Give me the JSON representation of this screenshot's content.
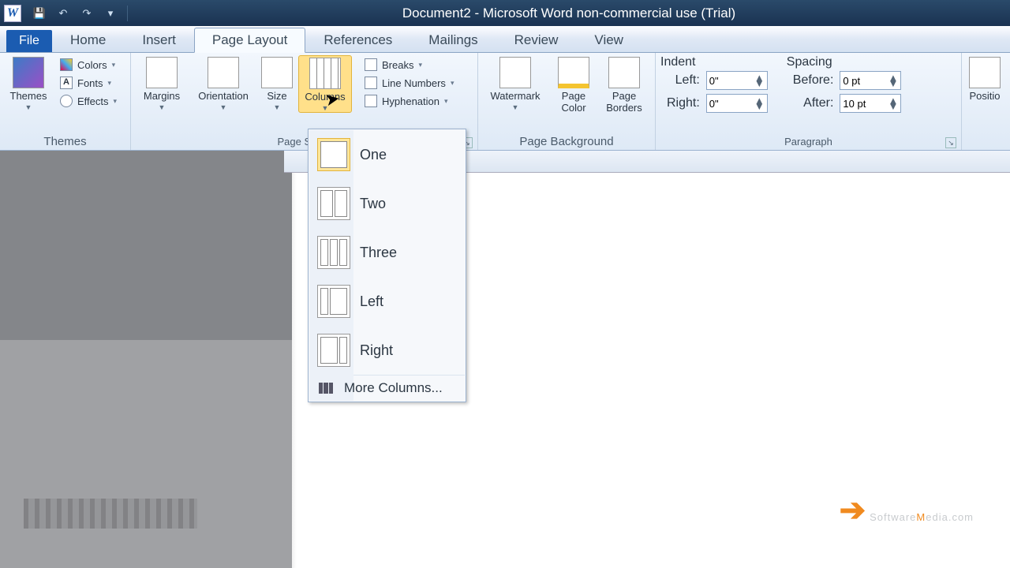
{
  "title": "Document2  -  Microsoft Word non-commercial use (Trial)",
  "app_icon_letter": "W",
  "tabs": {
    "file": "File",
    "home": "Home",
    "insert": "Insert",
    "page_layout": "Page Layout",
    "references": "References",
    "mailings": "Mailings",
    "review": "Review",
    "view": "View"
  },
  "groups": {
    "themes": {
      "label": "Themes",
      "main": "Themes",
      "colors": "Colors",
      "fonts": "Fonts",
      "effects": "Effects"
    },
    "page_setup": {
      "label": "Page Setup",
      "margins": "Margins",
      "orientation": "Orientation",
      "size": "Size",
      "columns": "Columns",
      "breaks": "Breaks",
      "line_numbers": "Line Numbers",
      "hyphenation": "Hyphenation"
    },
    "page_background": {
      "label": "Page Background",
      "watermark": "Watermark",
      "page_color": "Page\nColor",
      "page_borders": "Page\nBorders"
    },
    "paragraph": {
      "label": "Paragraph",
      "indent": "Indent",
      "spacing": "Spacing",
      "left": "Left:",
      "right": "Right:",
      "before": "Before:",
      "after": "After:",
      "left_val": "0\"",
      "right_val": "0\"",
      "before_val": "0 pt",
      "after_val": "10 pt"
    },
    "arrange": {
      "position": "Positio"
    }
  },
  "columns_menu": {
    "one": "One",
    "two": "Two",
    "three": "Three",
    "left": "Left",
    "right": "Right",
    "more": "More Columns..."
  },
  "watermark": {
    "a": "S",
    "b": "oftware",
    "c": "M",
    "d": "edia",
    "e": ".com"
  }
}
